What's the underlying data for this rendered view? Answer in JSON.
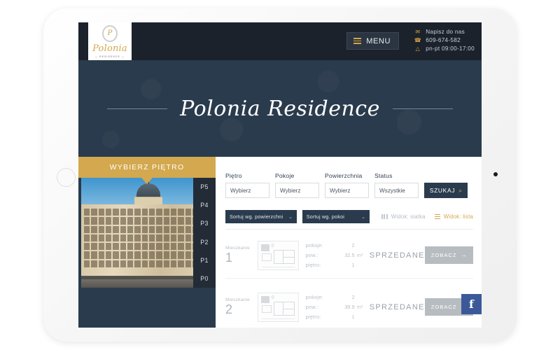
{
  "device": {
    "home_button": "home-button",
    "camera": "front-camera"
  },
  "header": {
    "logo": {
      "crest_initials": "P",
      "wordmark": "Polonia",
      "subtitle": "— RESIDENCE —"
    },
    "menu_label": "MENU",
    "contact": [
      {
        "icon": "mail-icon",
        "glyph": "✉",
        "text": "Napisz do nas"
      },
      {
        "icon": "phone-icon",
        "glyph": "☎",
        "text": "609-674-582"
      },
      {
        "icon": "clock-icon",
        "glyph": "△",
        "text": "pn-pt 09:00-17:00"
      }
    ]
  },
  "hero": {
    "title": "Polonia Residence"
  },
  "sidebar": {
    "banner_label": "WYBIERZ PIĘTRO",
    "photo_alt": "polonia-residence-building-photo",
    "floors": [
      "P5",
      "P4",
      "P3",
      "P2",
      "P1",
      "P0"
    ]
  },
  "filters": [
    {
      "label": "Piętro",
      "value": "Wybierz"
    },
    {
      "label": "Pokoje",
      "value": "Wybierz"
    },
    {
      "label": "Powierzchnia",
      "value": "Wybierz"
    },
    {
      "label": "Status",
      "value": "Wszystkie"
    }
  ],
  "search_button": {
    "label": "SZUKAJ",
    "icon": "search-icon",
    "glyph": "⌕"
  },
  "sort": {
    "options": [
      {
        "label": "Sortuj wg. powierzchni",
        "caret": "⌄"
      },
      {
        "label": "Sortuj wg. pokoi",
        "caret": "⌄"
      }
    ]
  },
  "views": {
    "grid": {
      "label": "Widok: siatka",
      "icon": "grid-view-icon",
      "active": false
    },
    "list": {
      "label": "Widok: lista",
      "icon": "list-view-icon",
      "active": true
    }
  },
  "listings": [
    {
      "word": "Mieszkanie",
      "number": "1",
      "plan_alt": "floorplan-thumbnail",
      "specs": [
        {
          "key": "pokoje:",
          "value": "2",
          "unit": ""
        },
        {
          "key": "pow.:",
          "value": "32.5",
          "unit": "m²"
        },
        {
          "key": "piętro:",
          "value": "1",
          "unit": ""
        }
      ],
      "status": "SPRZEDANE",
      "cta": {
        "label": "ZOBACZ",
        "arrow": "→"
      }
    },
    {
      "word": "Mieszkanie",
      "number": "2",
      "plan_alt": "floorplan-thumbnail",
      "specs": [
        {
          "key": "pokoje:",
          "value": "2",
          "unit": ""
        },
        {
          "key": "pow.:",
          "value": "39.9",
          "unit": "m²"
        },
        {
          "key": "piętro:",
          "value": "1",
          "unit": ""
        }
      ],
      "status": "SPRZEDANE",
      "cta": {
        "label": "ZOBACZ",
        "arrow": "→"
      }
    }
  ],
  "facebook_button": {
    "icon": "facebook-icon",
    "glyph": "f"
  },
  "colors": {
    "navy_dark": "#1b222c",
    "navy": "#2a3b4d",
    "gold": "#d3a84e",
    "facebook_blue": "#3b5998",
    "muted_grey": "#b7bcc1"
  }
}
